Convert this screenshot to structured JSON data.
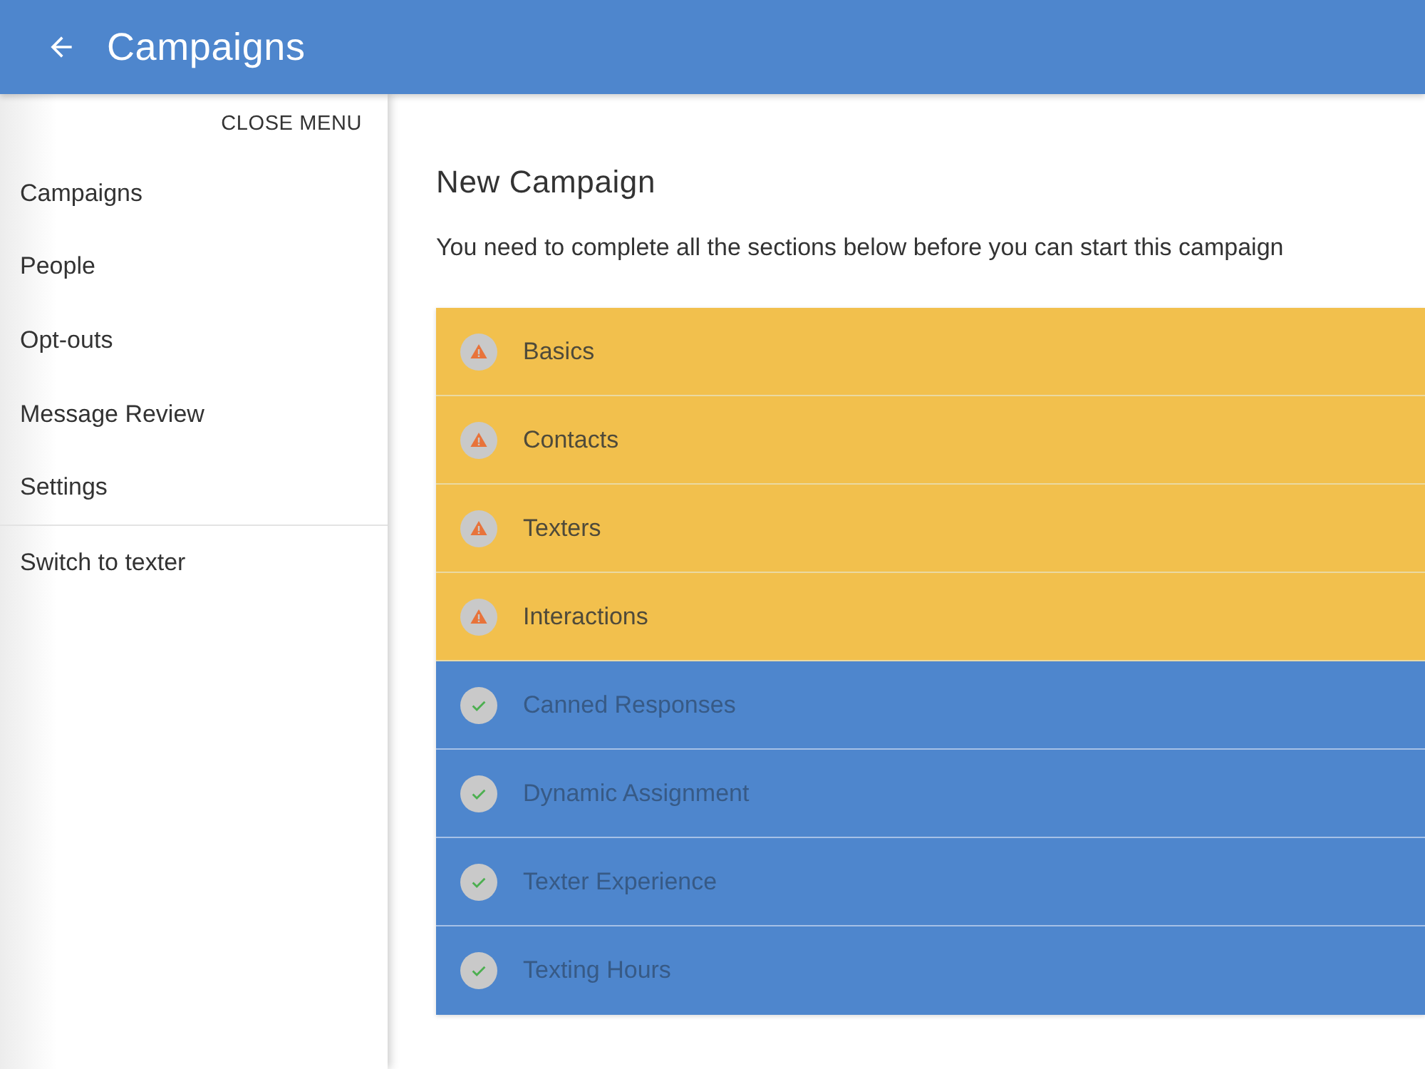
{
  "header": {
    "title": "Campaigns"
  },
  "sidebar": {
    "close_label": "CLOSE MENU",
    "items": [
      "Campaigns",
      "People",
      "Opt-outs",
      "Message Review",
      "Settings"
    ],
    "footer_items": [
      "Switch to texter"
    ]
  },
  "main": {
    "title": "New Campaign",
    "subtitle": "You need to complete all the sections below before you can start this campaign",
    "sections": [
      {
        "label": "Basics",
        "complete": false
      },
      {
        "label": "Contacts",
        "complete": false
      },
      {
        "label": "Texters",
        "complete": false
      },
      {
        "label": "Interactions",
        "complete": false
      },
      {
        "label": "Canned Responses",
        "complete": true
      },
      {
        "label": "Dynamic Assignment",
        "complete": true
      },
      {
        "label": "Texter Experience",
        "complete": true
      },
      {
        "label": "Texting Hours",
        "complete": true
      }
    ]
  }
}
